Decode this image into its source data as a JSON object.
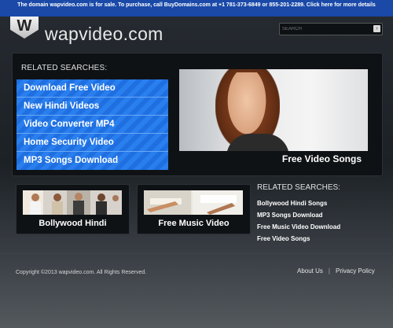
{
  "banner": {
    "text": "The domain wapvideo.com is for sale. To purchase, call BuyDomains.com at +1 781-373-6849 or 855-201-2289. Click here for more details"
  },
  "header": {
    "logo_letter": "W",
    "site_name": "wapvideo.com",
    "search_placeholder": "SEARCH"
  },
  "related_searches_main": {
    "title": "RELATED SEARCHES:",
    "items": [
      {
        "label": "Download Free Video"
      },
      {
        "label": "New Hindi Videos"
      },
      {
        "label": "Video Converter MP4"
      },
      {
        "label": "Home Security Video"
      },
      {
        "label": "MP3 Songs Download"
      }
    ]
  },
  "feature": {
    "caption": "Free Video Songs"
  },
  "thumbs": [
    {
      "caption": "Bollywood Hindi"
    },
    {
      "caption": "Free Music Video"
    }
  ],
  "related_searches_side": {
    "title": "RELATED SEARCHES:",
    "items": [
      {
        "label": "Bollywood Hindi Songs"
      },
      {
        "label": "MP3 Songs Download"
      },
      {
        "label": "Free Music Video Download"
      },
      {
        "label": "Free Video Songs"
      }
    ]
  },
  "footer": {
    "copyright": "Copyright ©2013 wapvideo.com. All Rights Reserved.",
    "about": "About Us",
    "separator": "|",
    "privacy": "Privacy Policy"
  },
  "colors": {
    "banner_blue": "#1a49a8",
    "list_blue": "#2a7fef",
    "page_dark": "#1e2328"
  }
}
